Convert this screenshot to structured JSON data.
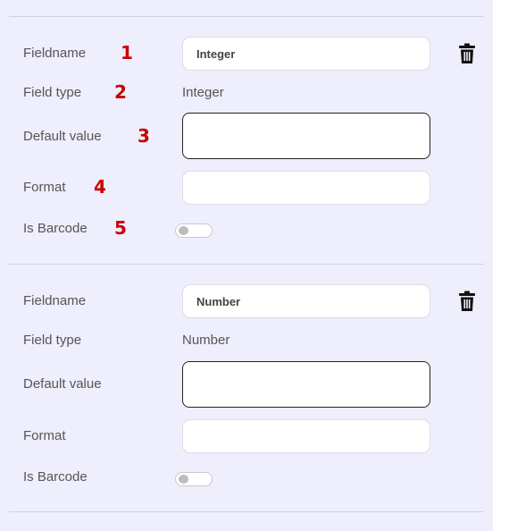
{
  "fields": [
    {
      "labels": {
        "fieldname": "Fieldname",
        "field_type": "Field type",
        "default_value": "Default value",
        "format": "Format",
        "is_barcode": "Is Barcode"
      },
      "fieldname_value": "Integer",
      "field_type_value": "Integer",
      "default_value": "",
      "format_value": "",
      "is_barcode": false,
      "markers": [
        "1",
        "2",
        "3",
        "4",
        "5"
      ]
    },
    {
      "labels": {
        "fieldname": "Fieldname",
        "field_type": "Field type",
        "default_value": "Default value",
        "format": "Format",
        "is_barcode": "Is Barcode"
      },
      "fieldname_value": "Number",
      "field_type_value": "Number",
      "default_value": "",
      "format_value": "",
      "is_barcode": false
    }
  ],
  "icons": {
    "delete": "trash-icon"
  },
  "colors": {
    "panel_background": "#eeeefc",
    "marker_red": "#c80000",
    "label_gray": "#555555"
  }
}
